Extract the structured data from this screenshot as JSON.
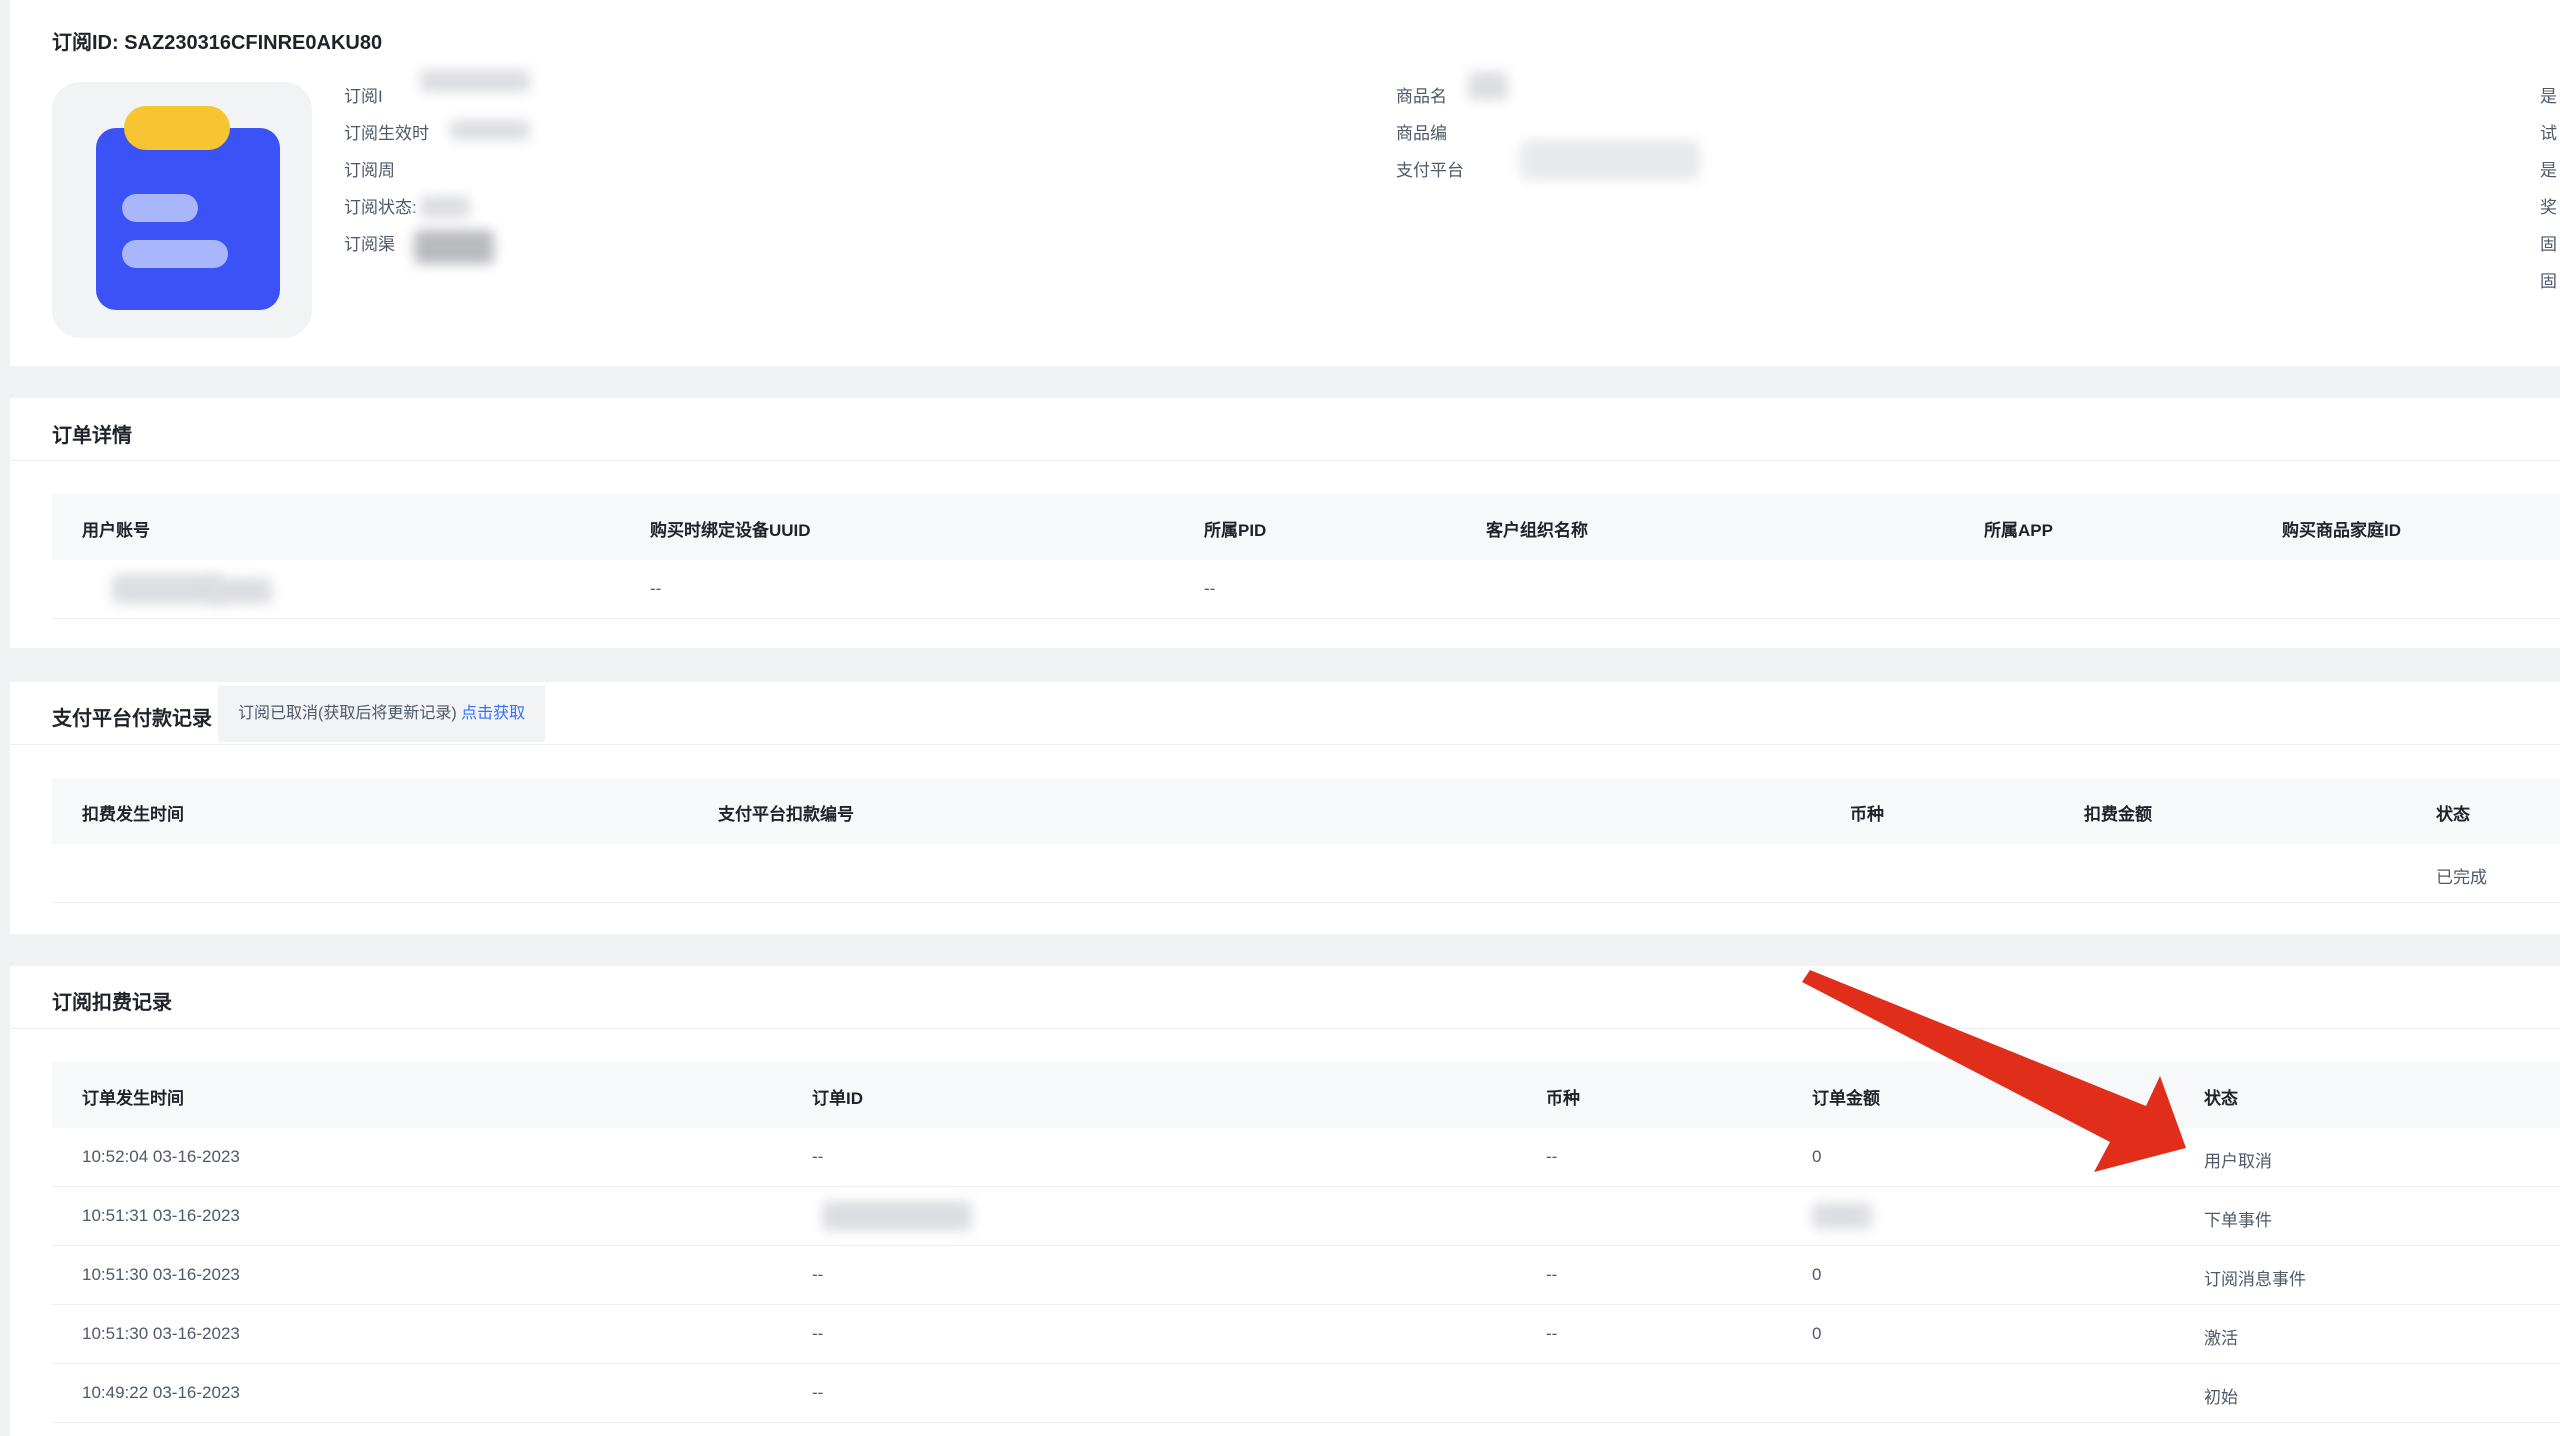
{
  "header": {
    "order_id": "订阅ID: SAZ230316CFINRE0AKU80",
    "meta_left": [
      "订阅I",
      "订阅生效时",
      "订阅周",
      "订阅状态:",
      "订阅渠"
    ],
    "meta_mid": [
      "商品名",
      "商品编",
      "支付平台"
    ],
    "meta_right": [
      "是",
      "试",
      "是",
      "奖",
      "固",
      "固"
    ]
  },
  "order_details": {
    "title": "订单详情",
    "columns": [
      "用户账号",
      "购买时绑定设备UUID",
      "所属PID",
      "客户组织名称",
      "所属APP",
      "购买商品家庭ID"
    ],
    "row": [
      "",
      "--",
      "--",
      "",
      "",
      ""
    ]
  },
  "payments": {
    "title": "支付平台付款记录",
    "notice": "订阅已取消(获取后将更新记录)",
    "notice_link": "点击获取",
    "columns": [
      "扣费发生时间",
      "支付平台扣款编号",
      "币种",
      "扣费金额",
      "状态"
    ],
    "row": [
      "",
      "",
      "",
      "",
      "已完成"
    ]
  },
  "charges": {
    "title": "订阅扣费记录",
    "columns": [
      "订单发生时间",
      "订单ID",
      "币种",
      "订单金额",
      "状态"
    ],
    "rows": [
      [
        "10:52:04 03-16-2023",
        "--",
        "--",
        "0",
        "用户取消"
      ],
      [
        "10:51:31 03-16-2023",
        "",
        "",
        "",
        "下单事件"
      ],
      [
        "10:51:30 03-16-2023",
        "--",
        "--",
        "0",
        "订阅消息事件"
      ],
      [
        "10:51:30 03-16-2023",
        "--",
        "--",
        "0",
        "激活"
      ],
      [
        "10:49:22 03-16-2023",
        "--",
        "",
        "",
        "初始"
      ]
    ]
  },
  "annotation": {
    "arrow_color": "#e02e1b"
  },
  "colors": {
    "link": "#3370ff",
    "icon_board": "#3b52f6",
    "icon_clip": "#f7c531"
  }
}
